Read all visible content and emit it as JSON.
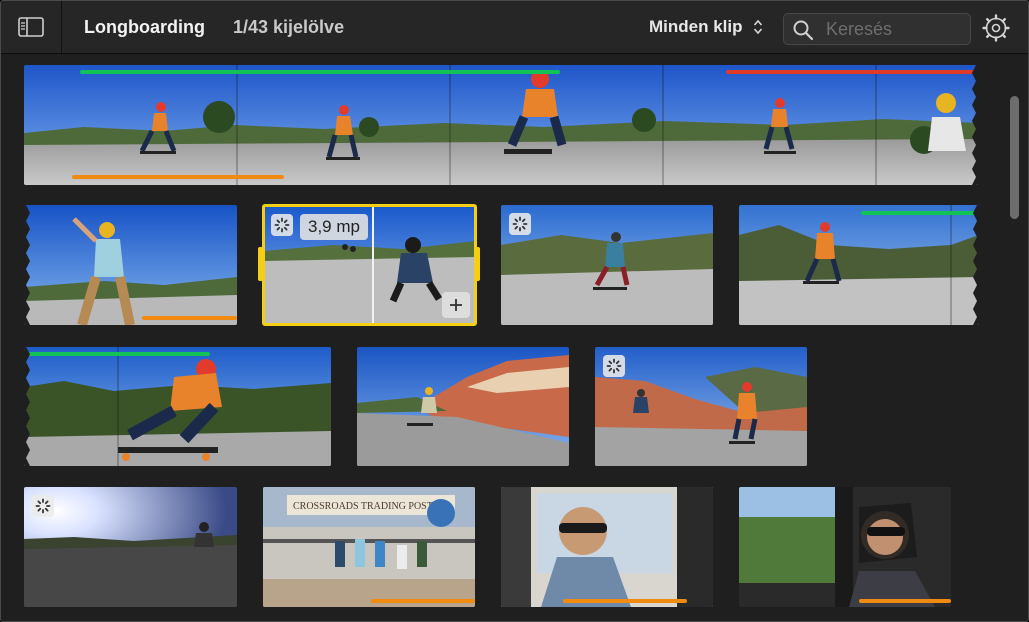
{
  "header": {
    "title": "Longboarding",
    "selection_count": "1/43 kijelölve",
    "filter_label": "Minden klip",
    "search_placeholder": "Keresés",
    "sidebar_icon": "sidebar-toggle-icon",
    "search_icon": "search-icon",
    "settings_icon": "gear-icon"
  },
  "selected_clip": {
    "duration": "3,9 mp"
  },
  "colors": {
    "favorite": "#12c257",
    "rejected": "#e03a2a",
    "audio": "#f08a10",
    "selection": "#f6cf14"
  },
  "icons": {
    "badge": "loading-spinner-icon",
    "add": "plus-icon"
  }
}
